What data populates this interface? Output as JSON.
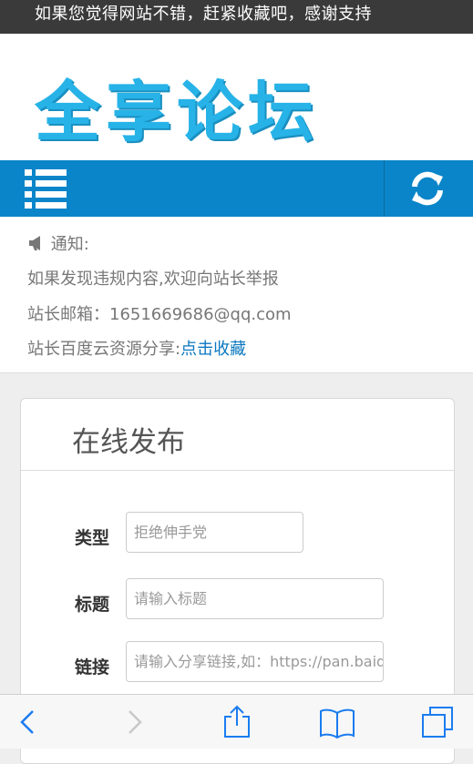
{
  "banner": {
    "text": "如果您觉得网站不错，赶紧收藏吧，感谢支持"
  },
  "site": {
    "logo_text": "全享论坛"
  },
  "notice": {
    "title": "通知:",
    "line1": "如果发现违规内容,欢迎向站长举报",
    "line2": "站长邮箱：1651669686@qq.com",
    "line3_prefix": "站长百度云资源分享:",
    "line3_link": "点击收藏"
  },
  "form": {
    "title": "在线发布",
    "type_label": "类型",
    "type_value": "拒绝伸手党",
    "title_label": "标题",
    "title_placeholder": "请输入标题",
    "link_label": "链接",
    "link_placeholder": "请输入分享链接,如：https://pan.baidu.com"
  },
  "colors": {
    "nav": "#0a85c9",
    "logo": "#27b3e8",
    "link": "#0a77c0"
  },
  "icons": [
    "menu-icon",
    "refresh-icon",
    "megaphone-icon",
    "back-icon",
    "forward-icon",
    "share-icon",
    "bookmarks-icon",
    "tabs-icon"
  ]
}
